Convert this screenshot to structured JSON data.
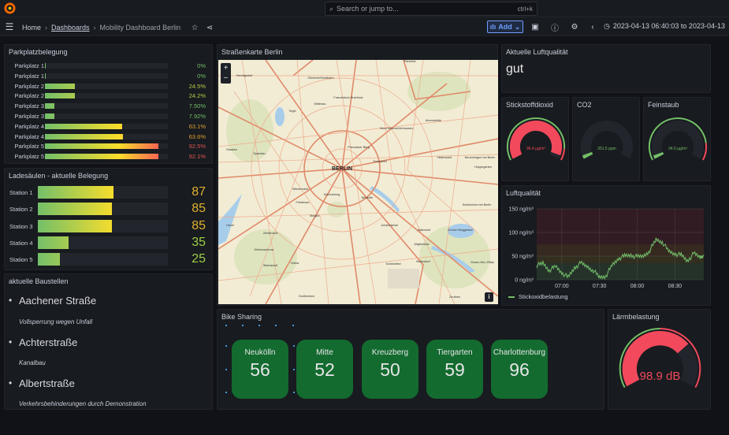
{
  "header": {
    "search_placeholder": "Search or jump to...",
    "search_shortcut": "ctrl+k",
    "breadcrumb": [
      "Home",
      "Dashboards",
      "Mobility Dashboard Berlin"
    ],
    "add_label": "Add",
    "time_range": "2023-04-13 06:40:03 to 2023-04-13"
  },
  "parking": {
    "title": "Parkplatzbelegung",
    "items": [
      {
        "label": "Parkplatz 1",
        "value": 0,
        "text": "0%"
      },
      {
        "label": "Parkplatz 1",
        "value": 0,
        "text": "0%"
      },
      {
        "label": "Parkplatz 2",
        "value": 24.5,
        "text": "24.5%"
      },
      {
        "label": "Parkplatz 2",
        "value": 24.2,
        "text": "24.2%"
      },
      {
        "label": "Parkplatz 3",
        "value": 7.5,
        "text": "7.50%"
      },
      {
        "label": "Parkplatz 3",
        "value": 7.92,
        "text": "7.92%"
      },
      {
        "label": "Parkplatz 4",
        "value": 63.1,
        "text": "63.1%"
      },
      {
        "label": "Parkplatz 4",
        "value": 63.6,
        "text": "63.6%"
      },
      {
        "label": "Parkplatz 5",
        "value": 92.5,
        "text": "92.5%"
      },
      {
        "label": "Parkplatz 5",
        "value": 92.1,
        "text": "92.1%"
      }
    ]
  },
  "charging": {
    "title": "Ladesäulen - aktuelle Belegung",
    "max": 150,
    "items": [
      {
        "label": "Station 1",
        "value": 87
      },
      {
        "label": "Station 2",
        "value": 85
      },
      {
        "label": "Station 3",
        "value": 85
      },
      {
        "label": "Station 4",
        "value": 35
      },
      {
        "label": "Station 5",
        "value": 25
      }
    ]
  },
  "construction": {
    "title": "aktuelle Baustellen",
    "items": [
      {
        "street": "Aachener Straße",
        "desc": "Vollsperrung wegen Unfall"
      },
      {
        "street": "Achterstraße",
        "desc": "Kanalbau"
      },
      {
        "street": "Albertstraße",
        "desc": "Verkehrsbehinderungen durch Demonstration"
      }
    ]
  },
  "map": {
    "title": "Straßenkarte Berlin",
    "zoom_in": "+",
    "zoom_out": "−",
    "info": "i",
    "labels": [
      "Hennigsdorf",
      "Glienicke/Nordbahn",
      "Französisch Buchholz",
      "Wittenau",
      "Tegel",
      "Panketal",
      "Ahrensfelde",
      "Neu-Hohenschönhausen",
      "Prenzlauer Berg",
      "Staaken",
      "Spandau",
      "Fennpfuhl",
      "Hellersdorf",
      "Neuenhagen bei Berlin",
      "Hoppegarten",
      "BERLIN",
      "Wilmersdorf",
      "Schöneberg",
      "Neukölln",
      "Friedenau",
      "Steglitz",
      "Schöneiche bei Berlin",
      "Johannisthal",
      "Adlershof",
      "Großer Müggelsee",
      "Zehlendorf",
      "Kleinmachnow",
      "Altglienicke",
      "Teltow",
      "Stahnsdorf",
      "Schönefeld",
      "Bohnsdorf",
      "Gosen-Neu Zittau",
      "Großbeeren",
      "Zeuthen",
      "Havel"
    ]
  },
  "air_quality": {
    "title": "Aktuelle Luftqualität",
    "value": "gut"
  },
  "gauges": [
    {
      "title": "Stickstoffdioxid",
      "value": 96.4,
      "text": "96.4 µg/m³",
      "min": 0,
      "max": 100,
      "threshold": 90,
      "color": "#f2495c"
    },
    {
      "title": "CO2",
      "value": 351.5,
      "text": "351.5 ppm",
      "min": 0,
      "max": 10000,
      "threshold": null,
      "color": "#73bf69"
    },
    {
      "title": "Feinstaub",
      "value": 34.0,
      "text": "34.0 µg/m³",
      "min": 0,
      "max": 1000,
      "threshold": 850,
      "color": "#73bf69"
    }
  ],
  "noise": {
    "title": "Lärmbelastung",
    "value": 98.9,
    "text": "98.9 dB",
    "min": 0,
    "max": 140,
    "threshold": 70,
    "color": "#f2495c"
  },
  "bike": {
    "title": "Bike Sharing",
    "items": [
      {
        "name": "Neukölln",
        "value": "56"
      },
      {
        "name": "Mitte",
        "value": "52"
      },
      {
        "name": "Kreuzberg",
        "value": "50"
      },
      {
        "name": "Tiergarten",
        "value": "59"
      },
      {
        "name": "Charlottenburg",
        "value": "96"
      }
    ]
  },
  "chart_data": {
    "type": "line",
    "title": "Luftqualität",
    "xlabel": "",
    "ylabel": "",
    "ylim": [
      0,
      150
    ],
    "yticks": [
      "0 ng/m³",
      "50 ng/m³",
      "100 ng/m³",
      "150 ng/m³"
    ],
    "xticks": [
      "07:00",
      "07:30",
      "08:00",
      "08:30"
    ],
    "xrange_minutes": [
      400,
      533
    ],
    "legend": "bottom-left",
    "grid": true,
    "series": [
      {
        "name": "Stickoxidbelastung",
        "color": "#73bf69",
        "x": [
          400,
          405,
          410,
          415,
          420,
          425,
          430,
          435,
          440,
          445,
          450,
          455,
          460,
          465,
          470,
          475,
          480,
          485,
          490,
          495,
          500,
          505,
          510,
          515,
          520,
          525,
          530,
          533
        ],
        "y": [
          30,
          35,
          20,
          28,
          15,
          5,
          25,
          35,
          28,
          20,
          5,
          8,
          30,
          45,
          50,
          52,
          48,
          50,
          62,
          85,
          80,
          60,
          55,
          52,
          40,
          55,
          48,
          52
        ]
      }
    ],
    "bands": [
      {
        "from": 0,
        "to": 35,
        "color": "#73bf69"
      },
      {
        "from": 35,
        "to": 50,
        "color": "#c8a82a"
      },
      {
        "from": 50,
        "to": 75,
        "color": "#e0802a"
      },
      {
        "from": 75,
        "to": 150,
        "color": "#c4283c"
      }
    ]
  }
}
